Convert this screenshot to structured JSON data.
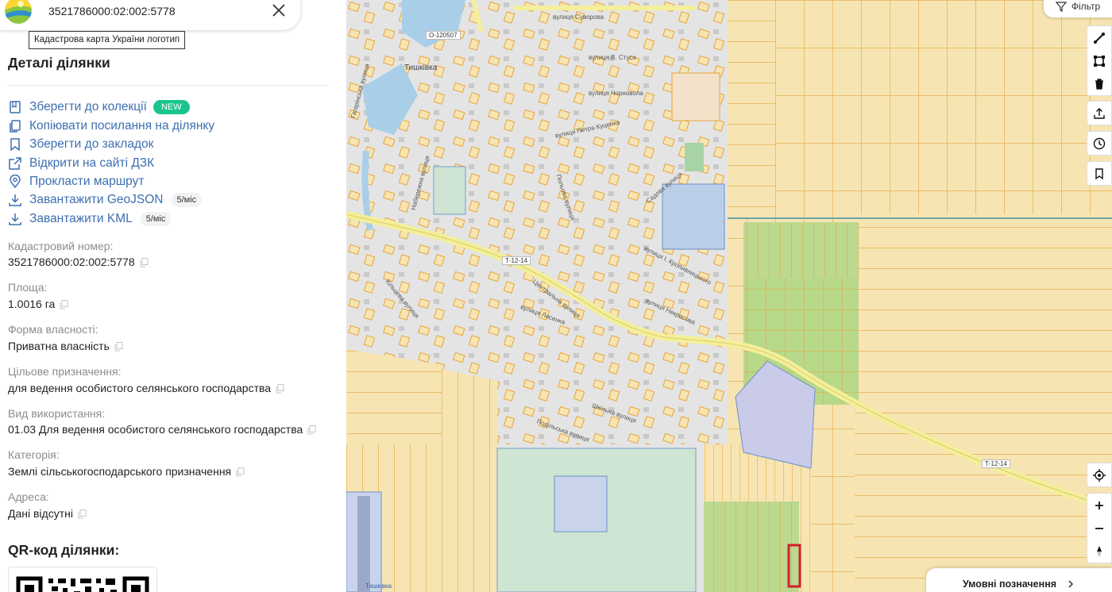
{
  "search": {
    "value": "3521786000:02:002:5778",
    "logo_tooltip": "Кадастрова карта України логотип"
  },
  "panel": {
    "title": "Деталі ділянки",
    "actions": [
      {
        "label": "Зберегти до колекції",
        "icon": "collection-icon",
        "badge": "NEW"
      },
      {
        "label": "Копіювати посилання на ділянку",
        "icon": "copy-link-icon"
      },
      {
        "label": "Зберегти до закладок",
        "icon": "bookmark-icon"
      },
      {
        "label": "Відкрити на сайті ДЗК",
        "icon": "external-link-icon"
      },
      {
        "label": "Прокласти маршрут",
        "icon": "location-pin-icon"
      },
      {
        "label": "Завантажити GeoJSON",
        "icon": "download-icon",
        "badge": "5/міс"
      },
      {
        "label": "Завантажити KML",
        "icon": "download-icon",
        "badge": "5/міс"
      }
    ],
    "fields": [
      {
        "label": "Кадастровий номер:",
        "value": "3521786000:02:002:5778"
      },
      {
        "label": "Площа:",
        "value": "1.0016 га"
      },
      {
        "label": "Форма власності:",
        "value": "Приватна власність"
      },
      {
        "label": "Цільове призначення:",
        "value": "для ведення особистого селянського господарства"
      },
      {
        "label": "Вид використання:",
        "value": "01.03 Для ведення особистого селянського господарства"
      },
      {
        "label": "Категорія:",
        "value": "Землі сільськогосподарського призначення"
      },
      {
        "label": "Адреса:",
        "value": "Дані відсутні"
      }
    ],
    "qr_title": "QR-код ділянки:"
  },
  "map": {
    "filter_label": "Фільтр",
    "legend_label": "Умовні позначення",
    "village_label": "Тишківка",
    "road_codes": [
      "О-120507",
      "Т-12-14",
      "Т-12-14"
    ],
    "streets": [
      "вулиця Суворова",
      "вулиця В. Стуса",
      "вулиця Чорновола",
      "вулиця Петра Куценка",
      "Центральна вулиця",
      "Кільцева вулиця",
      "вулиця Лисенка",
      "вулиця Некрасова",
      "вулиця І. Кропивницького",
      "Польова вулиця",
      "Садова вулиця",
      "Шкільна вулиця",
      "Подільська вулиця",
      "Набережна вулиця",
      "Гагарінська вулиця"
    ],
    "airfield_label": "Тишківка",
    "colors": {
      "parcel_stroke": "#e8a53c",
      "parcel_fill": "#f5e6b8",
      "selected": "#d4202a",
      "green": "#b9d98a",
      "water": "#a9cfe8",
      "road": "#f4ef9a"
    }
  }
}
